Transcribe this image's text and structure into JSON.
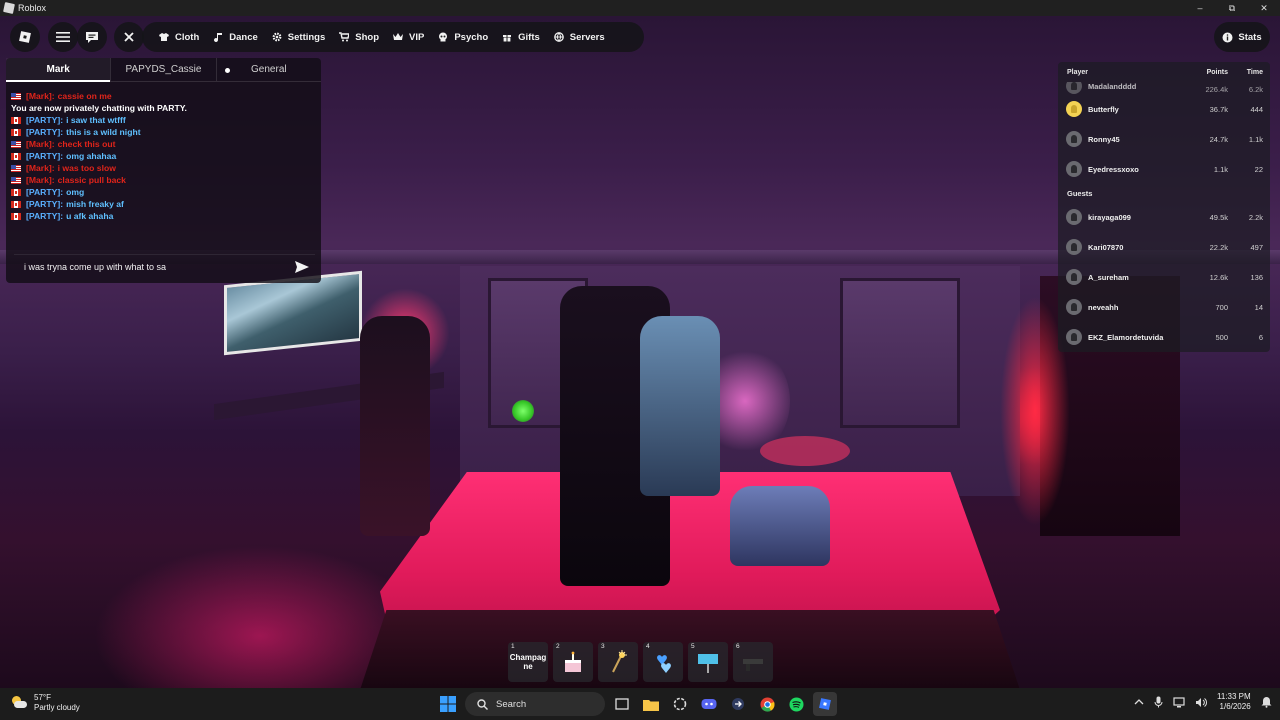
{
  "window": {
    "title": "Roblox",
    "minimize": "–",
    "restore": "⧉",
    "close": "✕"
  },
  "toolbar": {
    "menu_items": [
      {
        "label": "Cloth",
        "icon": "shirt-icon"
      },
      {
        "label": "Dance",
        "icon": "music-note-icon"
      },
      {
        "label": "Settings",
        "icon": "gear-icon"
      },
      {
        "label": "Shop",
        "icon": "cart-icon"
      },
      {
        "label": "VIP",
        "icon": "crown-icon"
      },
      {
        "label": "Psycho",
        "icon": "skull-icon"
      },
      {
        "label": "Gifts",
        "icon": "gift-icon"
      },
      {
        "label": "Servers",
        "icon": "globe-icon"
      }
    ],
    "stats_label": "Stats"
  },
  "chat": {
    "tabs": [
      "Mark",
      "PAPYDS_Cassie",
      "General"
    ],
    "active_tab": "Mark",
    "messages": [
      {
        "flag": "us",
        "sender": "[Mark]:",
        "text": "cassie on me",
        "color": "red"
      },
      {
        "flag": "",
        "sender": "",
        "text": "You are now privately chatting with PARTY.",
        "color": "system"
      },
      {
        "flag": "ca",
        "sender": "[PARTY]:",
        "text": "i saw that wtfff",
        "color": "blue"
      },
      {
        "flag": "ca",
        "sender": "[PARTY]:",
        "text": "this is a wild night",
        "color": "blue"
      },
      {
        "flag": "us",
        "sender": "[Mark]:",
        "text": "check this out",
        "color": "red"
      },
      {
        "flag": "ca",
        "sender": "[PARTY]:",
        "text": "omg ahahaa",
        "color": "blue"
      },
      {
        "flag": "us",
        "sender": "[Mark]:",
        "text": "i was too slow",
        "color": "red"
      },
      {
        "flag": "us",
        "sender": "[Mark]:",
        "text": "classic pull back",
        "color": "red"
      },
      {
        "flag": "ca",
        "sender": "[PARTY]:",
        "text": "omg",
        "color": "blue"
      },
      {
        "flag": "ca",
        "sender": "[PARTY]:",
        "text": "mish freaky af",
        "color": "blue"
      },
      {
        "flag": "ca",
        "sender": "[PARTY]:",
        "text": "u afk ahaha",
        "color": "blue"
      }
    ],
    "input_value": "i was tryna come up with what to sa"
  },
  "leaderboard": {
    "headers": {
      "player": "Player",
      "points": "Points",
      "time": "Time"
    },
    "partial_row": {
      "name": "Madalandddd",
      "points": "226.4k",
      "time": "6.2k"
    },
    "players": [
      {
        "name": "Butterfly",
        "points": "36.7k",
        "time": "444",
        "avatar": "gold"
      },
      {
        "name": "Ronny45",
        "points": "24.7k",
        "time": "1.1k",
        "avatar": "grey"
      },
      {
        "name": "Eyedressxoxo",
        "points": "1.1k",
        "time": "22",
        "avatar": "grey"
      }
    ],
    "guests_label": "Guests",
    "guests": [
      {
        "name": "kirayaga099",
        "points": "49.5k",
        "time": "2.2k"
      },
      {
        "name": "Kari07870",
        "points": "22.2k",
        "time": "497"
      },
      {
        "name": "A_sureham",
        "points": "12.6k",
        "time": "136"
      },
      {
        "name": "neveahh",
        "points": "700",
        "time": "14"
      },
      {
        "name": "EKZ_Elamordetuvida",
        "points": "500",
        "time": "6"
      }
    ]
  },
  "hotbar": [
    {
      "num": "1",
      "label": "Champag ne",
      "art": "text"
    },
    {
      "num": "2",
      "label": "",
      "art": "cake"
    },
    {
      "num": "3",
      "label": "",
      "art": "sparkler"
    },
    {
      "num": "4",
      "label": "",
      "art": "hearts"
    },
    {
      "num": "5",
      "label": "",
      "art": "sign"
    },
    {
      "num": "6",
      "label": "",
      "art": "gun"
    }
  ],
  "taskbar": {
    "weather_temp": "57°F",
    "weather_desc": "Partly cloudy",
    "search_label": "Search",
    "time": "11:33 PM",
    "date": "1/6/2026"
  }
}
